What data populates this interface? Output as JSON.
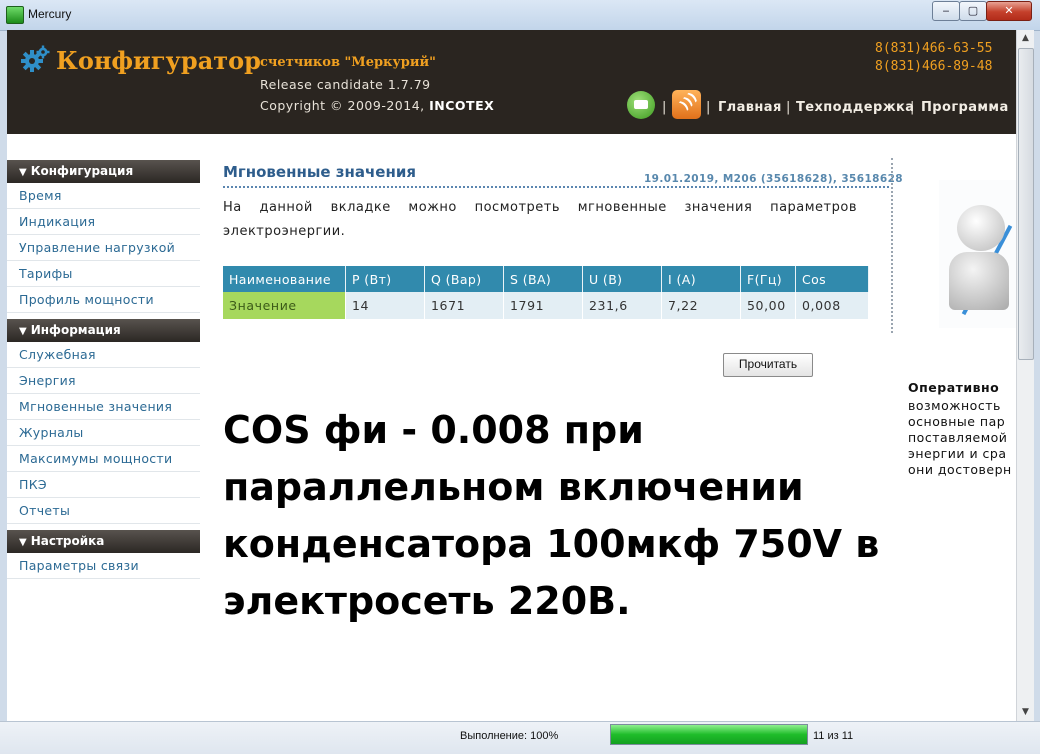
{
  "window": {
    "title": "Mercury",
    "minimize": "‒",
    "maximize": "▢",
    "close": "✕"
  },
  "header": {
    "brand": "Конфигуратор",
    "subtitle": "счетчиков \"Меркурий\"",
    "release": "Release candidate 1.7.79",
    "copyright_prefix": "Copyright © 2009-2014,",
    "copyright_company": "INCOTEX",
    "phones": [
      "8(831)466-63-55",
      "8(831)466-89-48"
    ],
    "nav": [
      "Главная",
      "Техподдержка",
      "Программа"
    ],
    "separator": "|"
  },
  "sidebar": {
    "sections": [
      {
        "title": "Конфигурация",
        "items": [
          "Время",
          "Индикация",
          "Управление нагрузкой",
          "Тарифы",
          "Профиль мощности"
        ]
      },
      {
        "title": "Информация",
        "items": [
          "Служебная",
          "Энергия",
          "Мгновенные значения",
          "Журналы",
          "Максимумы мощности",
          "ПКЭ",
          "Отчеты"
        ]
      },
      {
        "title": "Настройка",
        "items": [
          "Параметры связи"
        ]
      }
    ]
  },
  "main": {
    "heading": "Мгновенные значения",
    "meta": "19.01.2019, M206 (35618628), 35618628",
    "description": "На данной вкладке можно посмотреть мгновенные значения параметров электроэнергии.",
    "table": {
      "headers": [
        "Наименование",
        "P (Вт)",
        "Q (Вар)",
        "S (ВА)",
        "U (В)",
        "I (А)",
        "F(Гц)",
        "Cos"
      ],
      "row": [
        "Значение",
        "14",
        "1671",
        "1791",
        "231,6",
        "7,22",
        "50,00",
        "0,008"
      ]
    },
    "read_button": "Прочитать",
    "overlay_lines": [
      "COS фи - 0.008 при",
      "параллельном включении",
      "конденсатора 100мкф 750V в",
      "электросеть 220В."
    ]
  },
  "right_panel": {
    "title": "Оперативно",
    "lines": [
      "возможность",
      "основные пар",
      "поставляемой",
      "энергии и сра",
      "они достоверн"
    ]
  },
  "status": {
    "label": "Выполнение: 100%",
    "progress": 1.0,
    "count": "11 из 11"
  }
}
